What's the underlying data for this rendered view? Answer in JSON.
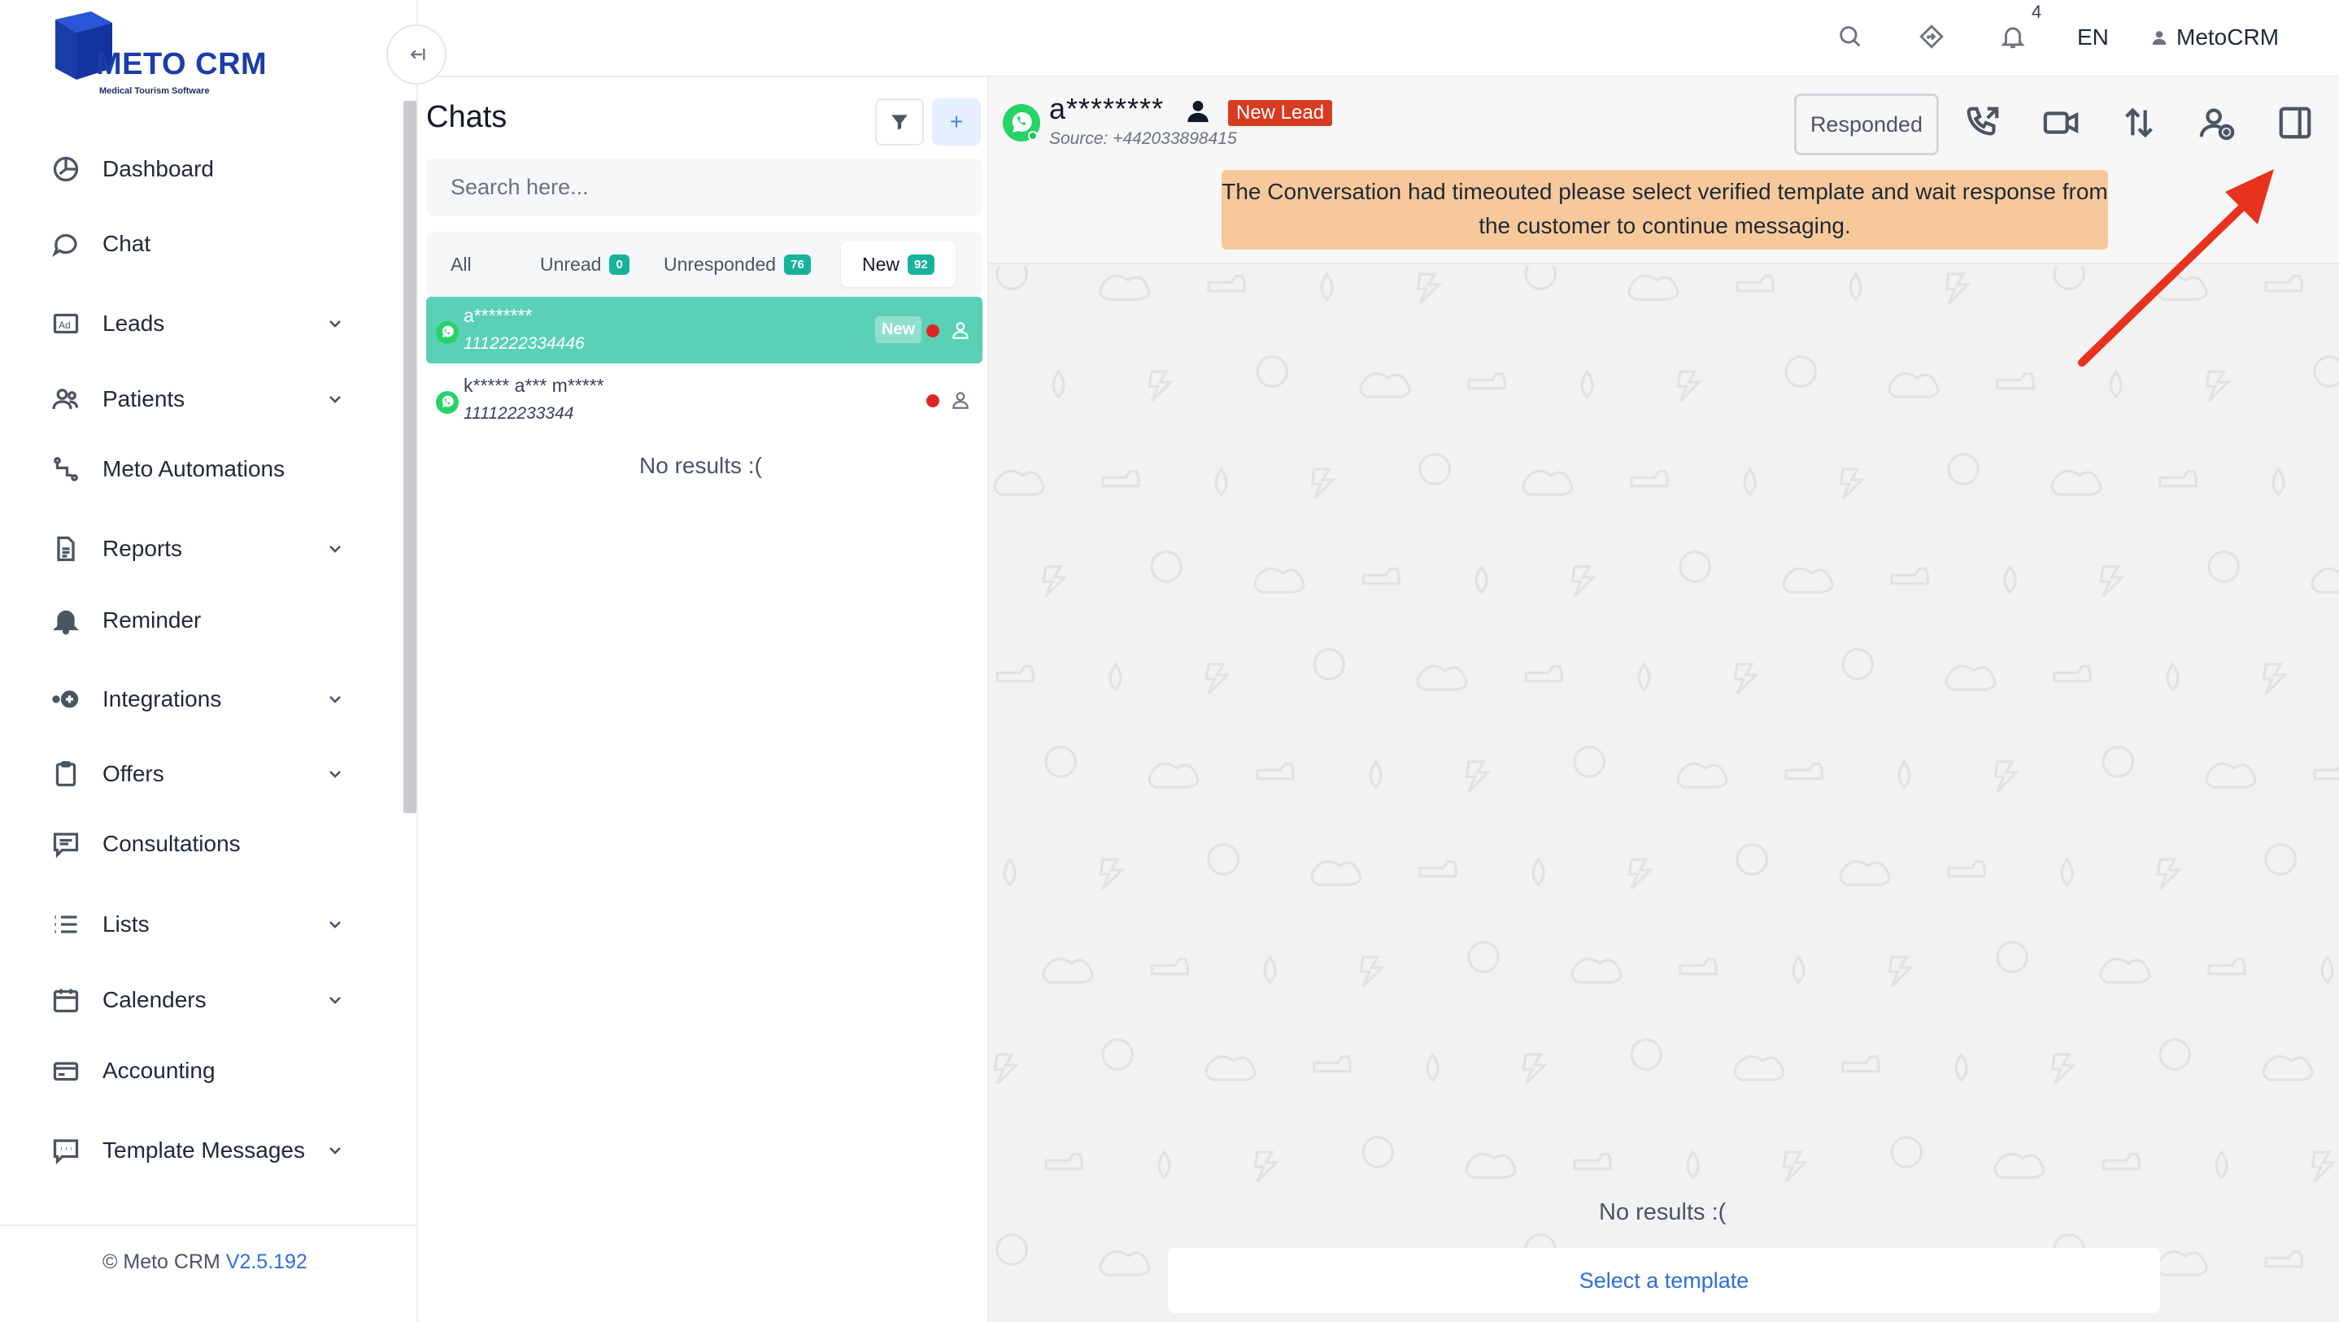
{
  "brand": {
    "name": "METO CRM",
    "tagline": "Medical Tourism Software"
  },
  "sidebar": {
    "items": [
      {
        "label": "Dashboard",
        "icon": "dashboard-icon",
        "expandable": false
      },
      {
        "label": "Chat",
        "icon": "chat-icon",
        "expandable": false
      },
      {
        "label": "Leads",
        "icon": "ad-icon",
        "expandable": true
      },
      {
        "label": "Patients",
        "icon": "users-icon",
        "expandable": true
      },
      {
        "label": "Meto Automations",
        "icon": "workflow-icon",
        "expandable": false
      },
      {
        "label": "Reports",
        "icon": "document-icon",
        "expandable": true
      },
      {
        "label": "Reminder",
        "icon": "bell-icon",
        "expandable": false
      },
      {
        "label": "Integrations",
        "icon": "integration-icon",
        "expandable": true
      },
      {
        "label": "Offers",
        "icon": "clipboard-icon",
        "expandable": true
      },
      {
        "label": "Consultations",
        "icon": "message-icon",
        "expandable": false
      },
      {
        "label": "Lists",
        "icon": "list-icon",
        "expandable": true
      },
      {
        "label": "Calenders",
        "icon": "calendar-icon",
        "expandable": true
      },
      {
        "label": "Accounting",
        "icon": "card-icon",
        "expandable": false
      },
      {
        "label": "Template Messages",
        "icon": "template-icon",
        "expandable": true
      }
    ],
    "footer_prefix": "© Meto CRM ",
    "footer_version": "V2.5.192"
  },
  "topbar": {
    "notification_count": "4",
    "language": "EN",
    "user_name": "MetoCRM"
  },
  "chat_list": {
    "title": "Chats",
    "search_placeholder": "Search here...",
    "tabs": [
      {
        "label": "All",
        "count": null
      },
      {
        "label": "Unread",
        "count": "0"
      },
      {
        "label": "Unresponded",
        "count": "76"
      },
      {
        "label": "New",
        "count": "92",
        "active": true
      }
    ],
    "chats": [
      {
        "name": "a********",
        "phone": "1112222334446",
        "tag": "New",
        "selected": true
      },
      {
        "name": "k***** a*** m*****",
        "phone": "111122233344",
        "tag": null,
        "selected": false
      }
    ],
    "empty_text": "No results :("
  },
  "conversation": {
    "contact_name": "a********",
    "lead_badge": "New Lead",
    "source": "Source: +442033898415",
    "responded_label": "Responded",
    "timeout_banner": "The Conversation had timeouted please select verified template and wait response from the customer to continue messaging.",
    "empty_text": "No results :(",
    "select_template": "Select a template"
  },
  "colors": {
    "brand_blue": "#1a3ea8",
    "selected_chat": "#5ad1b7",
    "badge_teal": "#16b39a",
    "lead_red": "#d93a22",
    "banner_orange": "#f7c99a",
    "arrow_red": "#e8321e",
    "link_blue": "#2e6fd6"
  }
}
